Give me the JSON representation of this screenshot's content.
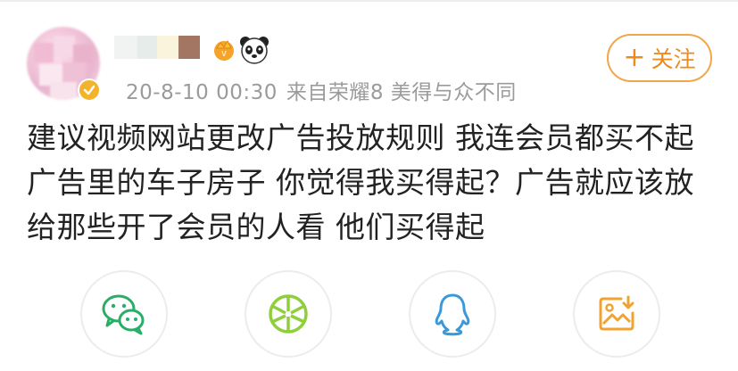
{
  "post": {
    "timestamp": "20-8-10 00:30",
    "source": "来自荣耀8 美得与众不同",
    "follow_label": "关注",
    "follow_plus": "+",
    "text": "建议视频网站更改广告投放规则 我连会员都买不起 广告里的车子房子 你觉得我买得起？广告就应该放给那些开了会员的人看 他们买得起"
  },
  "icons": {
    "verified": "verified-badge-icon",
    "vip": "vip-crown-icon",
    "panda": "panda-emoji-icon"
  },
  "share": {
    "items": [
      "wechat",
      "wechat-moments",
      "qq",
      "save-image"
    ]
  },
  "colors": {
    "accent": "#ef8a1d",
    "wechat": "#2aae67",
    "moments": "#8fcf3c",
    "qq": "#3a9ad9",
    "save": "#f0a332",
    "meta_text": "#9b9b9b",
    "body_text": "#222222"
  }
}
